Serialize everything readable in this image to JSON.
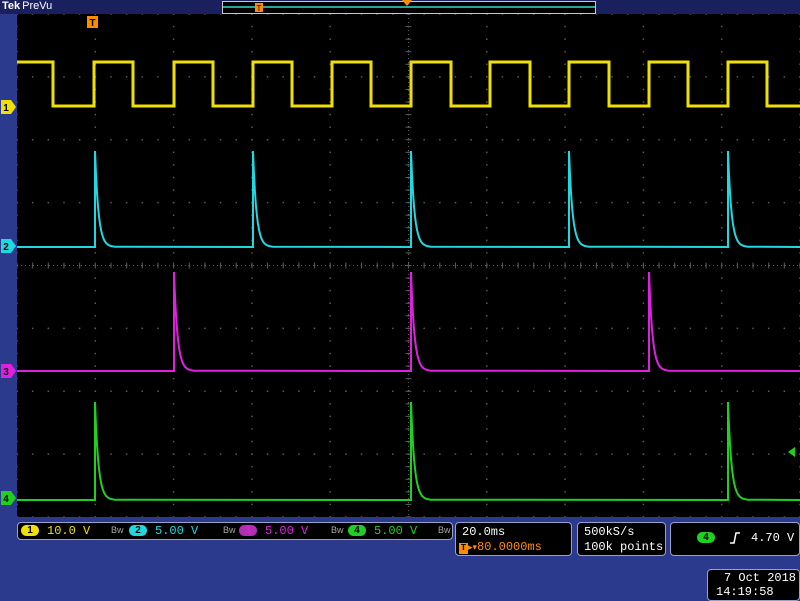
{
  "brand": {
    "name": "Tek",
    "mode": "PreVu"
  },
  "markers": {
    "trigger_symbol": "T",
    "ground_labels": [
      "1",
      "2",
      "3",
      "4"
    ]
  },
  "colors": {
    "ch1": "#f0e000",
    "ch2": "#20d8e0",
    "ch3": "#e020e0",
    "ch4": "#20d020",
    "trigger": "#ff8c00",
    "grid": "#5a5a5a"
  },
  "channels": [
    {
      "num": "1",
      "scale": "10.0 V",
      "bw_icon": "bandwidth-limit-icon"
    },
    {
      "num": "2",
      "scale": "5.00 V",
      "bw_icon": "bandwidth-limit-icon"
    },
    {
      "num": "3",
      "scale": "5.00 V",
      "bw_icon": "bandwidth-limit-icon"
    },
    {
      "num": "4",
      "scale": "5.00 V",
      "bw_icon": "bandwidth-limit-icon"
    }
  ],
  "bw_glyph": "Bw",
  "timebase": {
    "scale": "20.0ms",
    "position": "80.0000ms"
  },
  "acquisition": {
    "rate": "500kS/s",
    "points": "100k points"
  },
  "trigger": {
    "source": "4",
    "slope_icon": "rising-edge-icon",
    "level": "4.70 V"
  },
  "datetime": {
    "date": "7 Oct  2018",
    "time": "14:19:58"
  }
}
